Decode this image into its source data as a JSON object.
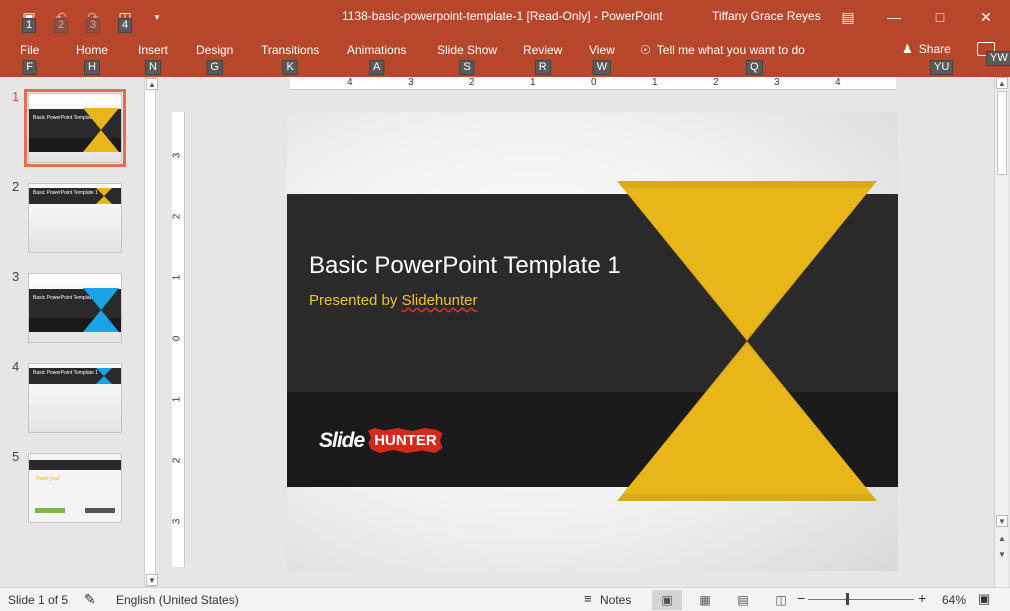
{
  "window": {
    "title": "1138-basic-powerpoint-template-1 [Read-Only]  -  PowerPoint",
    "user": "Tiffany Grace Reyes"
  },
  "qat": [
    {
      "icon": "save-icon",
      "keytip": "1"
    },
    {
      "icon": "undo-icon",
      "keytip": "2"
    },
    {
      "icon": "redo-icon",
      "keytip": "3"
    },
    {
      "icon": "start-slideshow-icon",
      "keytip": "4"
    }
  ],
  "tabs": [
    {
      "label": "File",
      "keytip": "F"
    },
    {
      "label": "Home",
      "keytip": "H"
    },
    {
      "label": "Insert",
      "keytip": "N"
    },
    {
      "label": "Design",
      "keytip": "G"
    },
    {
      "label": "Transitions",
      "keytip": "K"
    },
    {
      "label": "Animations",
      "keytip": "A"
    },
    {
      "label": "Slide Show",
      "keytip": "S"
    },
    {
      "label": "Review",
      "keytip": "R"
    },
    {
      "label": "View",
      "keytip": "W"
    }
  ],
  "tellme": {
    "label": "Tell me what you want to do",
    "keytip": "Q"
  },
  "share": {
    "label": "Share",
    "keytip": "YU"
  },
  "comments": {
    "keytip": "YW"
  },
  "thumbnails": [
    {
      "num": "1",
      "title": "Basic PowerPoint Template 1",
      "accent": "#e9b619"
    },
    {
      "num": "2",
      "title": "Basic PowerPoint Template 1",
      "accent": "#e9b619"
    },
    {
      "num": "3",
      "title": "Basic PowerPoint Template 1",
      "accent": "#1aa3e6"
    },
    {
      "num": "4",
      "title": "Basic PowerPoint Template 1",
      "accent": "#1aa3e6"
    },
    {
      "num": "5",
      "title": "Thank you!",
      "accent": "#d42a1e"
    }
  ],
  "ruler": {
    "h_labels": [
      "4",
      "3",
      "2",
      "1",
      "0",
      "1",
      "2",
      "3",
      "4"
    ],
    "v_labels": [
      "3",
      "2",
      "1",
      "0",
      "1",
      "2",
      "3"
    ]
  },
  "slide": {
    "title": "Basic PowerPoint Template 1",
    "subtitle_prefix": "Presented by ",
    "subtitle_name": "Slidehunter",
    "logo_left": "Slide",
    "logo_right": "HUNTER",
    "colors": {
      "band": "#2a2a2a",
      "accent": "#e9b619",
      "text": "#ffffff"
    }
  },
  "status": {
    "slide_count": "Slide 1 of 5",
    "language": "English (United States)",
    "notes": "Notes",
    "zoom": "64%"
  }
}
